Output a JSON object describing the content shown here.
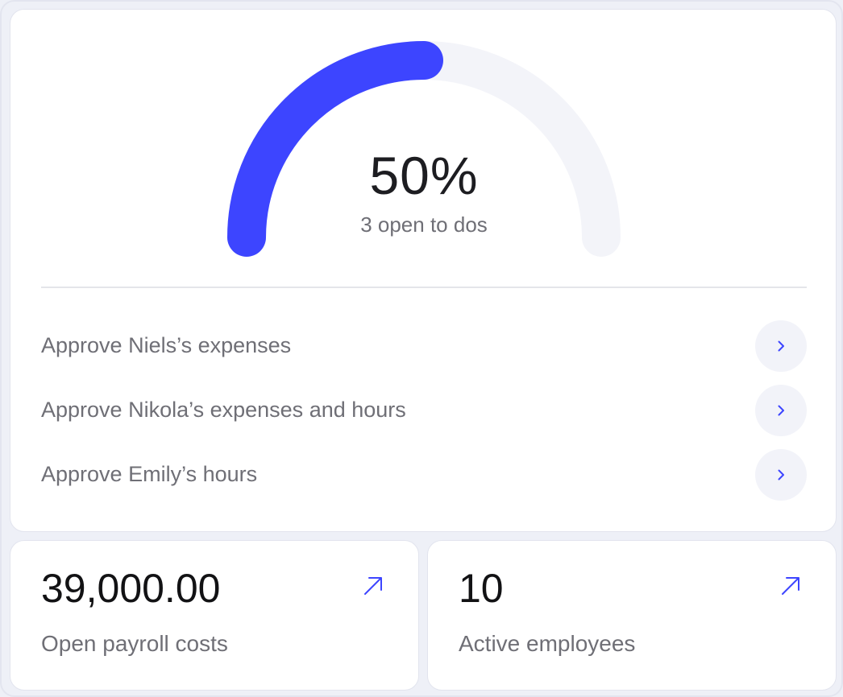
{
  "progress_card": {
    "percent_label": "50%",
    "progress_fraction": 0.5,
    "caption": "3 open to dos",
    "accent_color": "#3d45ff",
    "track_color": "#f3f4f9",
    "tasks": [
      {
        "label": "Approve Niels’s expenses",
        "icon": "chevron-right-icon"
      },
      {
        "label": "Approve Nikola’s expenses and hours",
        "icon": "chevron-right-icon"
      },
      {
        "label": "Approve Emily’s hours",
        "icon": "chevron-right-icon"
      }
    ]
  },
  "stats": [
    {
      "value": "39,000.00",
      "label": "Open payroll costs",
      "icon": "arrow-up-right-icon"
    },
    {
      "value": "10",
      "label": "Active employees",
      "icon": "arrow-up-right-icon"
    }
  ]
}
